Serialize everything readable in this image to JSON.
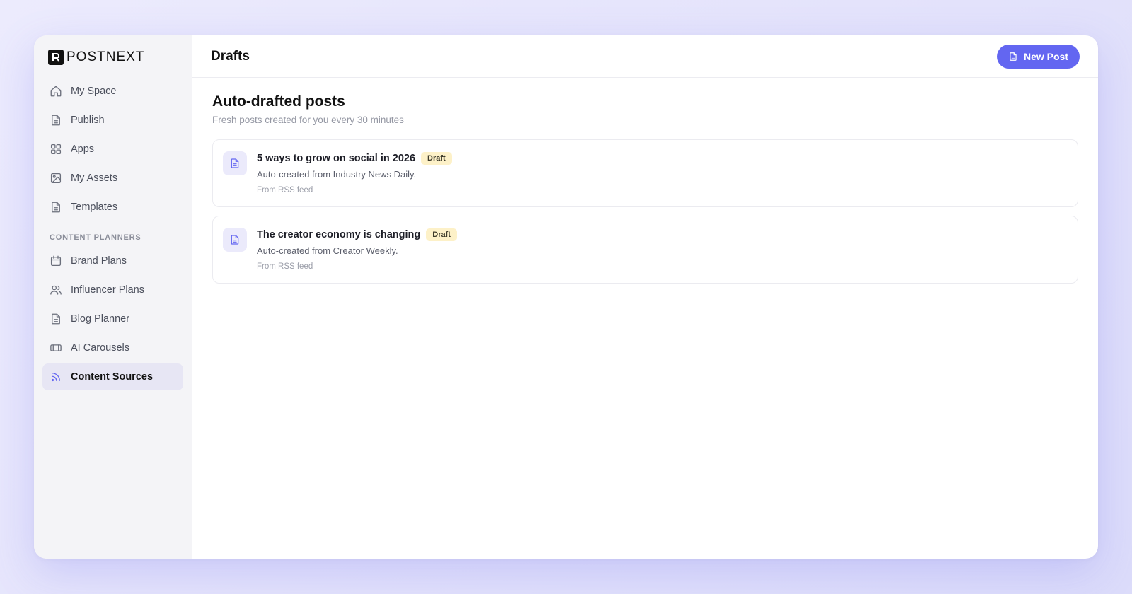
{
  "app": {
    "logo_text": "POSTNEXT"
  },
  "sidebar": {
    "items": [
      {
        "label": "My Space",
        "icon": "home-icon"
      },
      {
        "label": "Publish",
        "icon": "document-icon"
      },
      {
        "label": "Apps",
        "icon": "grid-icon"
      },
      {
        "label": "My Assets",
        "icon": "image-icon"
      },
      {
        "label": "Templates",
        "icon": "document-icon"
      }
    ],
    "section_label": "CONTENT PLANNERS",
    "planner_items": [
      {
        "label": "Brand Plans",
        "icon": "calendar-icon"
      },
      {
        "label": "Influencer Plans",
        "icon": "users-icon"
      },
      {
        "label": "Blog Planner",
        "icon": "document-icon"
      },
      {
        "label": "AI Carousels",
        "icon": "carousel-icon"
      },
      {
        "label": "Content Sources",
        "icon": "rss-icon",
        "active": true
      }
    ]
  },
  "header": {
    "title": "Drafts",
    "new_post_label": "New Post"
  },
  "main": {
    "title": "Auto-drafted posts",
    "subtitle": "Fresh posts created for you every 30 minutes",
    "posts": [
      {
        "title": "5 ways to grow on social in 2026",
        "badge": "Draft",
        "description": "Auto-created from Industry News Daily.",
        "source": "From RSS feed"
      },
      {
        "title": "The creator economy is changing",
        "badge": "Draft",
        "description": "Auto-created from Creator Weekly.",
        "source": "From RSS feed"
      }
    ]
  },
  "colors": {
    "accent": "#6366f1",
    "badge_bg": "#fdf1c8",
    "active_nav_bg": "#e7e6f4"
  }
}
